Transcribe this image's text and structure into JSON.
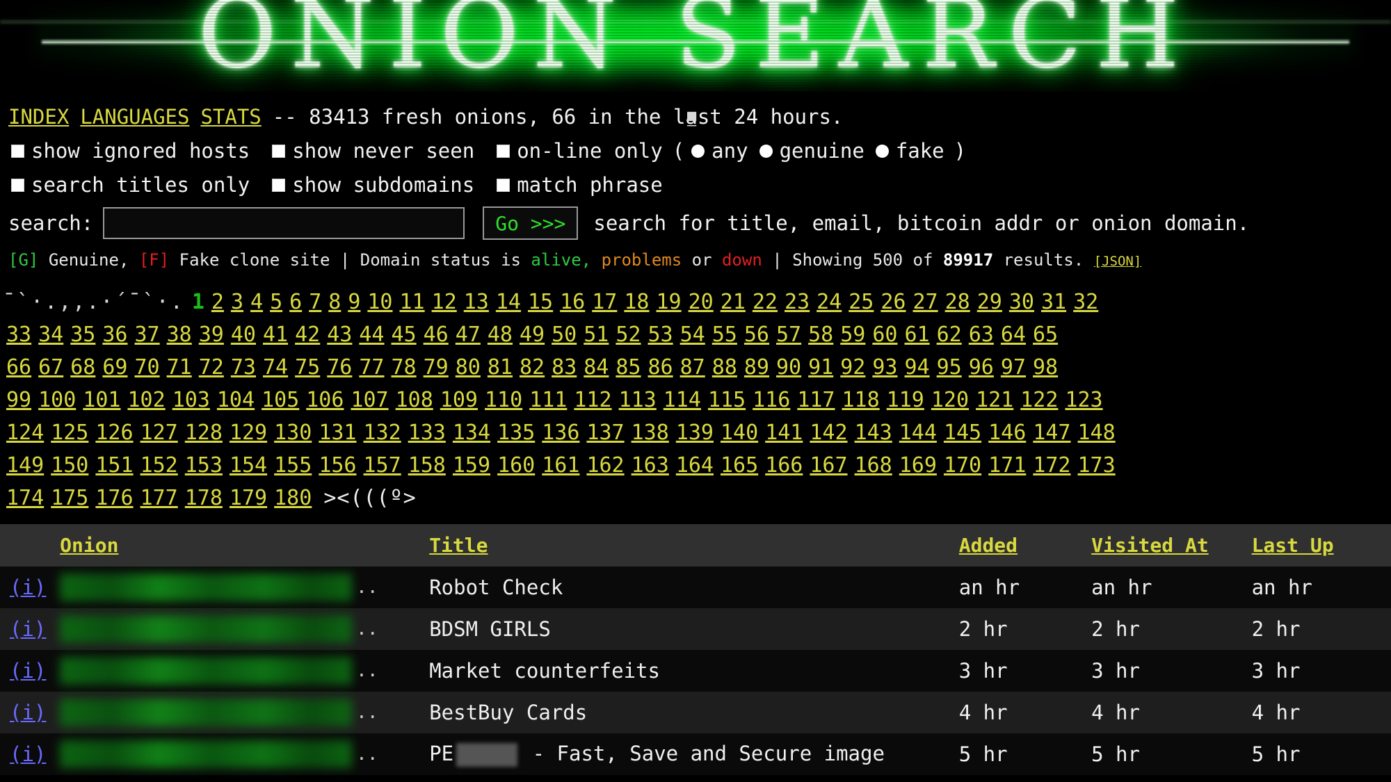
{
  "banner": {
    "logo_text": "ONION SEARCH"
  },
  "nav": {
    "links": [
      "INDEX",
      "LANGUAGES",
      "STATS"
    ],
    "separator": "--",
    "stats_text": "83413 fresh onions, 66 in the last 24 hours."
  },
  "options": {
    "row1": [
      {
        "label": "show ignored hosts",
        "type": "checkbox",
        "checked": false
      },
      {
        "label": "show never seen",
        "type": "checkbox",
        "checked": false
      },
      {
        "label": "on-line only",
        "type": "checkbox",
        "checked": false
      }
    ],
    "open_paren": "(",
    "close_paren": ")",
    "radios": [
      {
        "label": "any",
        "selected": true
      },
      {
        "label": "genuine",
        "selected": false
      },
      {
        "label": "fake",
        "selected": false
      }
    ],
    "row2": [
      {
        "label": "search titles only",
        "type": "checkbox",
        "checked": false
      },
      {
        "label": "show subdomains",
        "type": "checkbox",
        "checked": false
      },
      {
        "label": "match phrase",
        "type": "checkbox",
        "checked": false
      }
    ]
  },
  "search": {
    "label": "search:",
    "value": "",
    "placeholder": "",
    "button_label": "Go >>>",
    "hint": "search for title, email, bitcoin addr or onion domain."
  },
  "legend": {
    "g_tag": "[G]",
    "g_text": "Genuine,",
    "f_tag": "[F]",
    "f_text": "Fake clone site",
    "pipe1": "|",
    "status_prefix": "Domain status is",
    "alive": "alive,",
    "or_text": "problems",
    "or_word": "or",
    "down": "down",
    "pipe2": "|",
    "showing_prefix": "Showing 500 of",
    "result_count": "89917",
    "showing_suffix": "results.",
    "json_label": "[JSON]"
  },
  "pagination": {
    "ascii_prefix": "¯`·.,,.·´¯`·.",
    "current_page": 1,
    "total_pages": 180,
    "fish_art": "><(((º>",
    "rows": [
      [
        1,
        2,
        3,
        4,
        5,
        6,
        7,
        8,
        9,
        10,
        11,
        12,
        13,
        14,
        15,
        16,
        17,
        18,
        19,
        20,
        21,
        22,
        23,
        24,
        25,
        26,
        27,
        28,
        29,
        30,
        31,
        32
      ],
      [
        33,
        34,
        35,
        36,
        37,
        38,
        39,
        40,
        41,
        42,
        43,
        44,
        45,
        46,
        47,
        48,
        49,
        50,
        51,
        52,
        53,
        54,
        55,
        56,
        57,
        58,
        59,
        60,
        61,
        62,
        63,
        64,
        65
      ],
      [
        66,
        67,
        68,
        69,
        70,
        71,
        72,
        73,
        74,
        75,
        76,
        77,
        78,
        79,
        80,
        81,
        82,
        83,
        84,
        85,
        86,
        87,
        88,
        89,
        90,
        91,
        92,
        93,
        94,
        95,
        96,
        97,
        98
      ],
      [
        99,
        100,
        101,
        102,
        103,
        104,
        105,
        106,
        107,
        108,
        109,
        110,
        111,
        112,
        113,
        114,
        115,
        116,
        117,
        118,
        119,
        120,
        121,
        122,
        123
      ],
      [
        124,
        125,
        126,
        127,
        128,
        129,
        130,
        131,
        132,
        133,
        134,
        135,
        136,
        137,
        138,
        139,
        140,
        141,
        142,
        143,
        144,
        145,
        146,
        147,
        148
      ],
      [
        149,
        150,
        151,
        152,
        153,
        154,
        155,
        156,
        157,
        158,
        159,
        160,
        161,
        162,
        163,
        164,
        165,
        166,
        167,
        168,
        169,
        170,
        171,
        172,
        173
      ],
      [
        174,
        175,
        176,
        177,
        178,
        179,
        180
      ]
    ]
  },
  "table": {
    "headers": {
      "info": "",
      "onion": "Onion",
      "title": "Title",
      "added": "Added",
      "visited_at": "Visited At",
      "last_up": "Last Up"
    },
    "rows": [
      {
        "info": "(i)",
        "onion": "",
        "onion_redacted": true,
        "dots": "..",
        "title": "Robot Check",
        "title_redacted": false,
        "added": "an hr",
        "visited_at": "an hr",
        "last_up": "an hr"
      },
      {
        "info": "(i)",
        "onion": "",
        "onion_redacted": true,
        "dots": "..",
        "title": "BDSM GIRLS",
        "title_redacted": false,
        "added": "2 hr",
        "visited_at": "2 hr",
        "last_up": "2 hr"
      },
      {
        "info": "(i)",
        "onion": "",
        "onion_redacted": true,
        "dots": "..",
        "title": "Market counterfeits",
        "title_redacted": false,
        "added": "3 hr",
        "visited_at": "3 hr",
        "last_up": "3 hr"
      },
      {
        "info": "(i)",
        "onion": "",
        "onion_redacted": true,
        "dots": "..",
        "title": "BestBuy Cards",
        "title_redacted": false,
        "added": "4 hr",
        "visited_at": "4 hr",
        "last_up": "4 hr"
      },
      {
        "info": "(i)",
        "onion": "",
        "onion_redacted": true,
        "dots": "..",
        "title_prefix": "PE",
        "title_suffix": "- Fast, Save and Secure image",
        "title_redacted": true,
        "added": "5 hr",
        "visited_at": "5 hr",
        "last_up": "5 hr"
      }
    ]
  },
  "colors": {
    "link_yellow": "#d8d840",
    "current_page_green": "#18c018",
    "info_blue": "#6a6aff",
    "alive_green": "#2ecc40",
    "problems_orange": "#e08820",
    "down_red": "#e02020",
    "banner_green": "#00ff33",
    "header_bg": "#303030"
  }
}
